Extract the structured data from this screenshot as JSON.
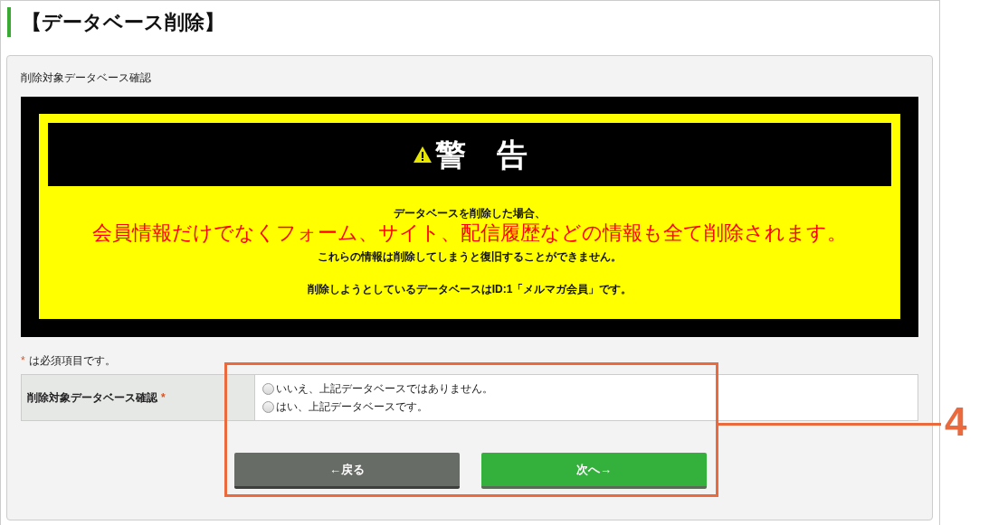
{
  "page_title": "【データベース削除】",
  "panel": {
    "heading": "削除対象データベース確認",
    "warning": {
      "title": "警　告",
      "lines": [
        {
          "kind": "normal",
          "text": "データベースを削除した場合、"
        },
        {
          "kind": "emphasis",
          "text": "会員情報だけでなくフォーム、サイト、配信履歴などの情報も全て削除されます。"
        },
        {
          "kind": "normal",
          "text": "これらの情報は削除してしまうと復旧することができません。"
        },
        {
          "kind": "gap",
          "text": "削除しようとしているデータベースはID:1「メルマガ会員」です。"
        }
      ]
    },
    "required_note": {
      "mark": "*",
      "text": "は必須項目です。"
    },
    "form": {
      "label": "削除対象データベース確認",
      "required_mark": "*",
      "options": [
        {
          "label": "いいえ、上記データベースではありません。",
          "selected": false
        },
        {
          "label": "はい、上記データベースです。",
          "selected": false
        }
      ]
    },
    "buttons": [
      {
        "kind": "back",
        "label": "←戻る"
      },
      {
        "kind": "next",
        "label": "次へ→"
      }
    ]
  },
  "callout": {
    "label": "4"
  }
}
